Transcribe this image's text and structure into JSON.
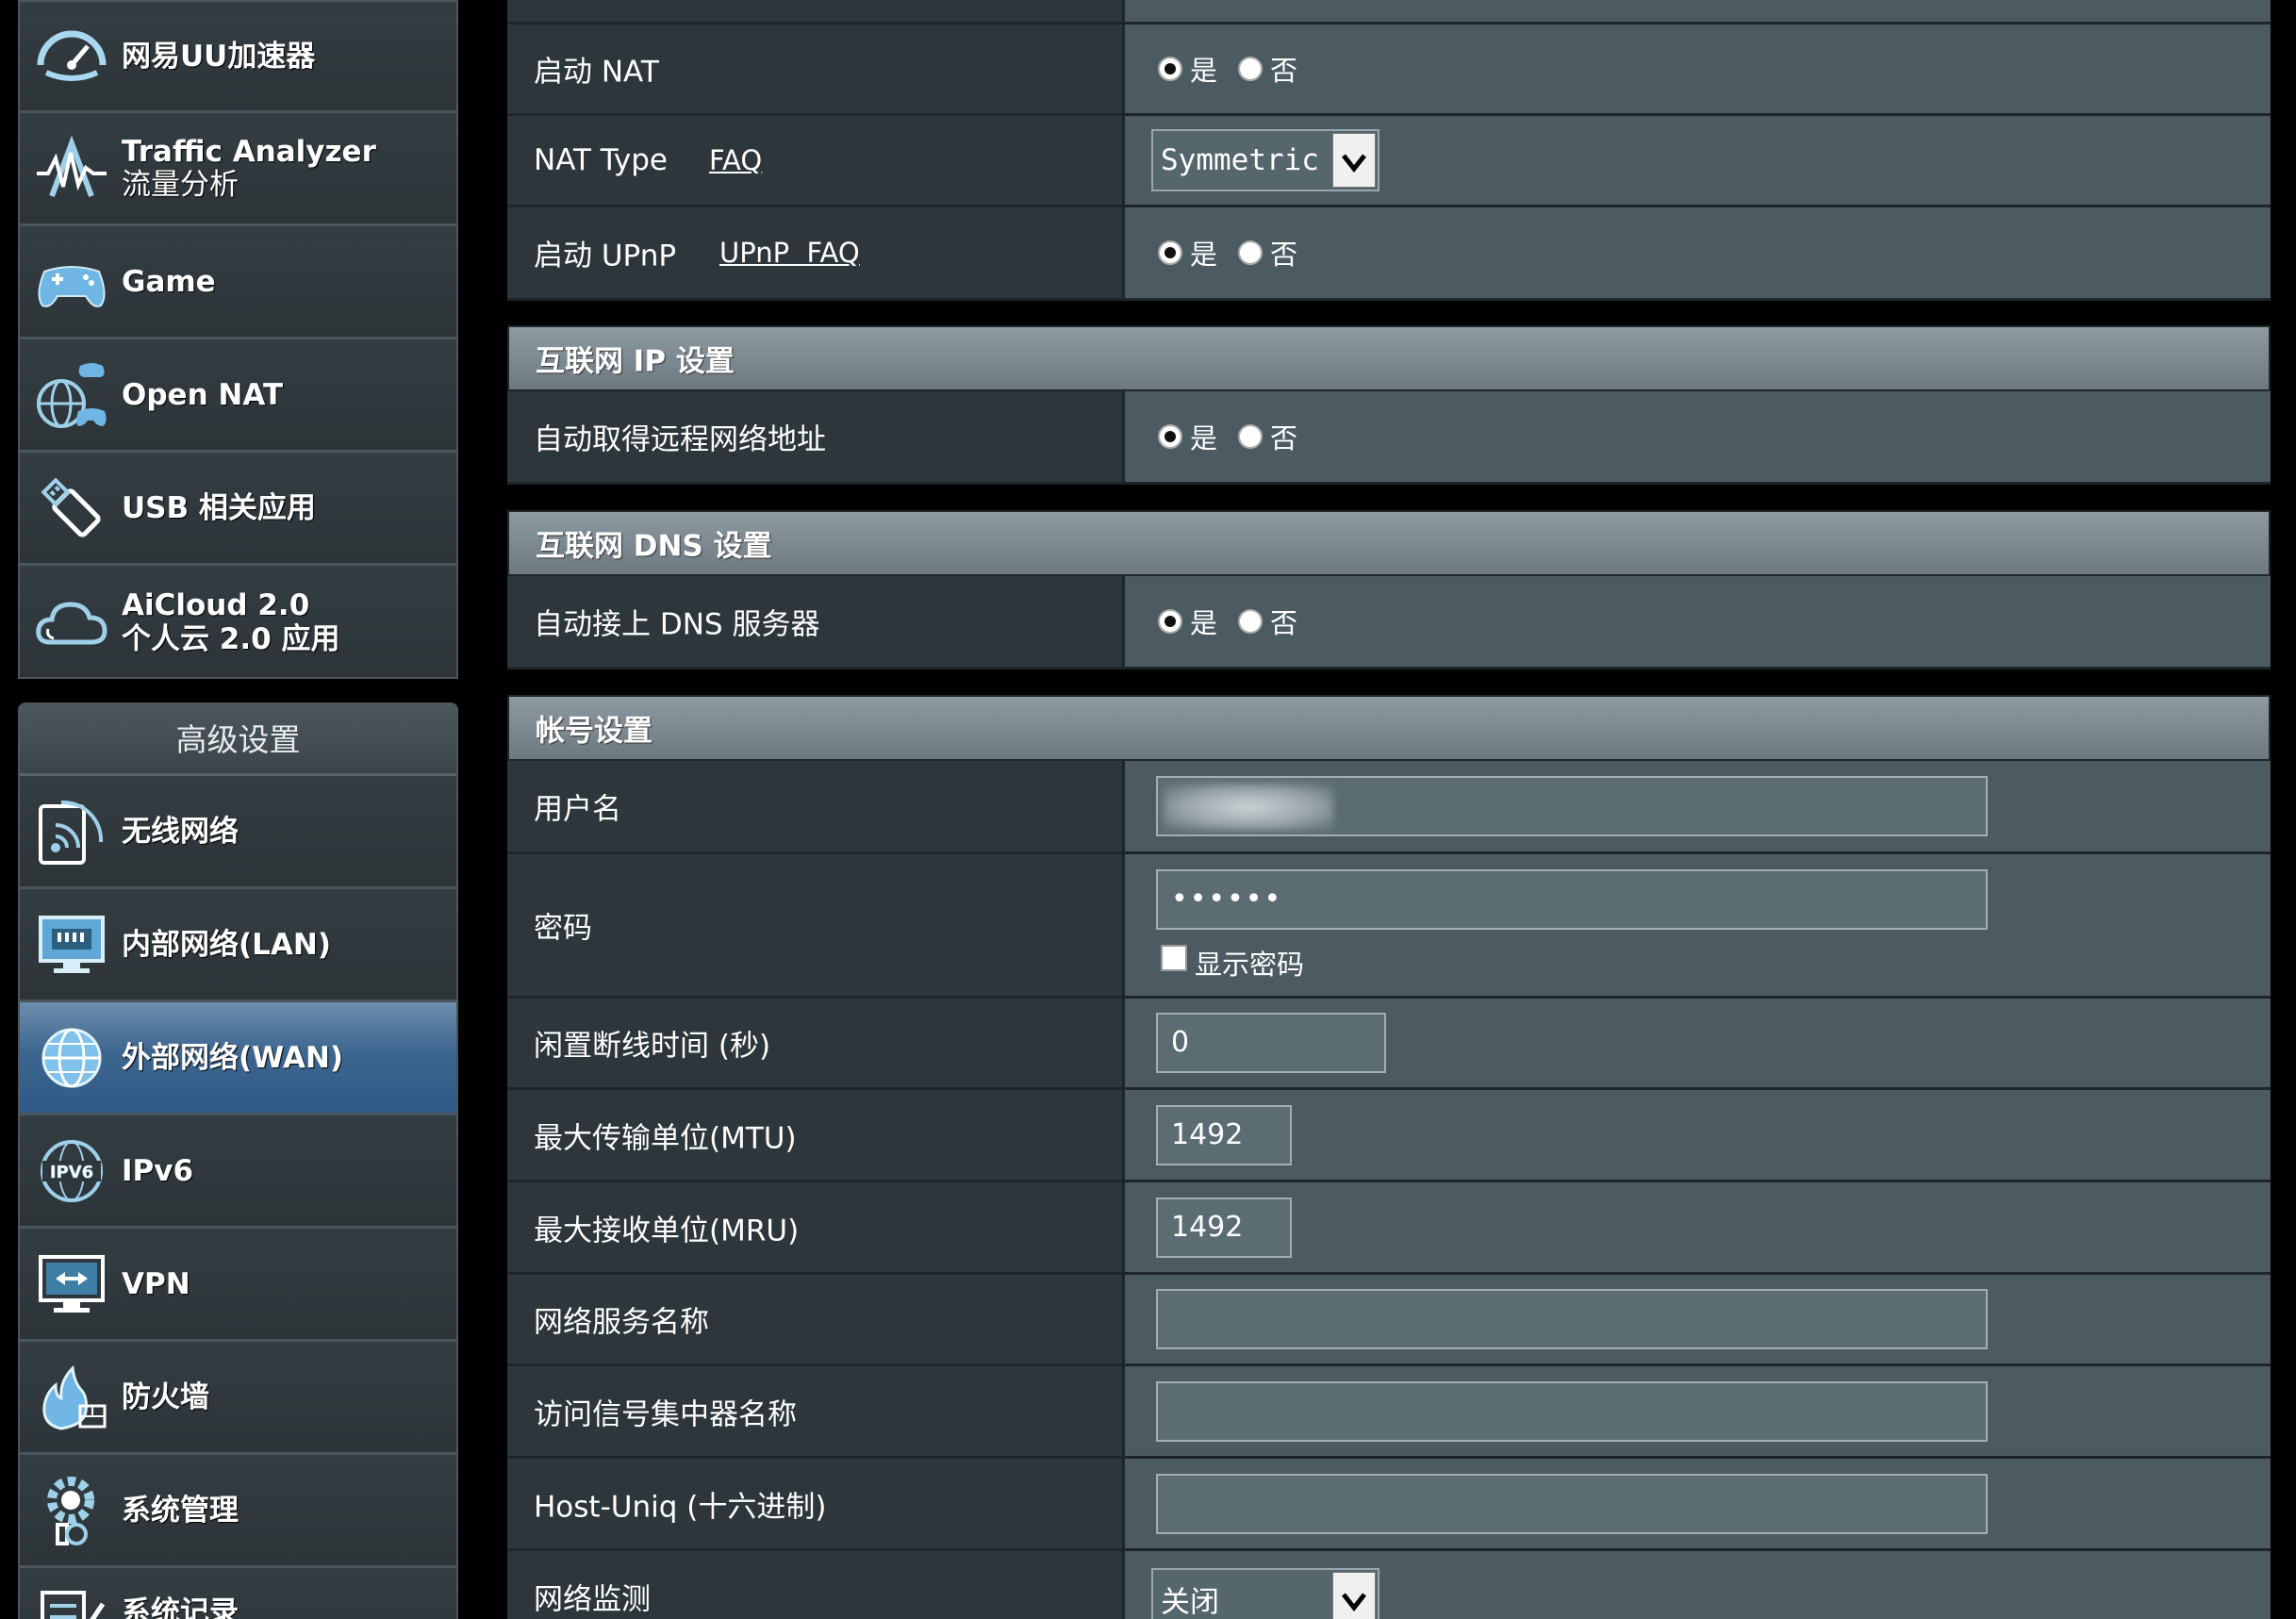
{
  "sidebar": {
    "top_items": [
      {
        "label": "网易UU加速器",
        "icon": "uu-gauge-icon"
      },
      {
        "label": "Traffic Analyzer",
        "label2": "流量分析",
        "icon": "traffic-pulse-icon"
      },
      {
        "label": "Game",
        "icon": "gamepad-icon"
      },
      {
        "label": "Open NAT",
        "icon": "globe-gamepad-icon"
      },
      {
        "label": "USB 相关应用",
        "icon": "usb-stick-icon"
      },
      {
        "label": "AiCloud 2.0",
        "label2": "个人云 2.0 应用",
        "icon": "cloud-icon"
      }
    ],
    "advanced_header": "高级设置",
    "advanced_items": [
      {
        "label": "无线网络",
        "icon": "wifi-icon"
      },
      {
        "label": "内部网络(LAN)",
        "icon": "lan-monitor-icon"
      },
      {
        "label": "外部网络(WAN)",
        "icon": "wan-globe-icon",
        "active": true
      },
      {
        "label": "IPv6",
        "icon": "ipv6-globe-icon"
      },
      {
        "label": "VPN",
        "icon": "vpn-monitor-icon"
      },
      {
        "label": "防火墙",
        "icon": "firewall-icon"
      },
      {
        "label": "系统管理",
        "icon": "admin-gear-icon"
      },
      {
        "label": "系统记录",
        "icon": "log-icon"
      }
    ]
  },
  "wan": {
    "nat": {
      "label": "启动 NAT",
      "yes": "是",
      "no": "否",
      "value": "是"
    },
    "nat_type": {
      "label": "NAT Type",
      "link": "FAQ",
      "value": "Symmetric"
    },
    "upnp": {
      "label": "启动 UPnP",
      "link": "UPnP  FAQ",
      "yes": "是",
      "no": "否",
      "value": "是"
    },
    "ip_section": {
      "title": "互联网 IP 设置"
    },
    "auto_ip": {
      "label": "自动取得远程网络地址",
      "yes": "是",
      "no": "否",
      "value": "是"
    },
    "dns_section": {
      "title": "互联网 DNS 设置"
    },
    "auto_dns": {
      "label": "自动接上 DNS 服务器",
      "yes": "是",
      "no": "否",
      "value": "是"
    },
    "account_section": {
      "title": "帐号设置"
    },
    "username": {
      "label": "用户名",
      "value": ""
    },
    "password": {
      "label": "密码",
      "value": "••••••",
      "show_label": "显示密码"
    },
    "idle_timeout": {
      "label": "闲置断线时间 (秒)",
      "value": "0"
    },
    "mtu": {
      "label": "最大传输单位(MTU)",
      "value": "1492"
    },
    "mru": {
      "label": "最大接收单位(MRU)",
      "value": "1492"
    },
    "service_name": {
      "label": "网络服务名称",
      "value": ""
    },
    "ac_name": {
      "label": "访问信号集中器名称",
      "value": ""
    },
    "host_uniq": {
      "label": "Host-Uniq (十六进制)",
      "value": ""
    },
    "net_monitor": {
      "label": "网络监测",
      "value": "关闭"
    }
  }
}
